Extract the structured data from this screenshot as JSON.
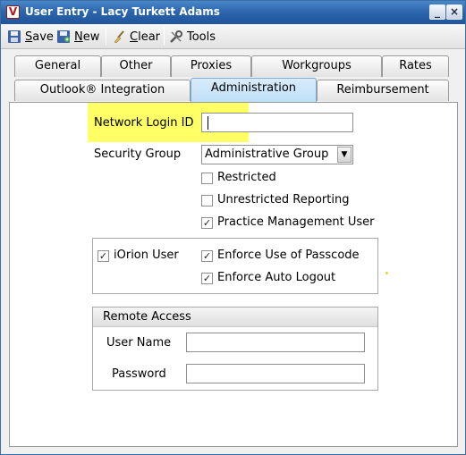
{
  "window": {
    "title": "User Entry - Lacy Turkett Adams",
    "min_glyph": "_",
    "close_glyph": "×"
  },
  "toolbar": {
    "save_label": "Save",
    "new_label": "New",
    "clear_label": "Clear",
    "tools_label": "Tools"
  },
  "tabs_row1": [
    {
      "label": "General"
    },
    {
      "label": "Other"
    },
    {
      "label": "Proxies"
    },
    {
      "label": "Workgroups"
    },
    {
      "label": "Rates"
    }
  ],
  "tabs_row2": [
    {
      "label": "Outlook® Integration"
    },
    {
      "label": "Administration",
      "active": true
    },
    {
      "label": "Reimbursement"
    }
  ],
  "admin": {
    "network_login_label": "Network Login ID",
    "network_login_value": "",
    "security_group_label": "Security Group",
    "security_group_value": "Administrative Group",
    "restricted_label": "Restricted",
    "restricted_checked": false,
    "unrestricted_label": "Unrestricted Reporting",
    "unrestricted_checked": false,
    "practice_label": "Practice Management User",
    "practice_checked": true,
    "iorion_label": "iOrion User",
    "iorion_checked": true,
    "passcode_label": "Enforce Use of Passcode",
    "passcode_checked": true,
    "autologout_label": "Enforce Auto Logout",
    "autologout_checked": true
  },
  "remote_access": {
    "title": "Remote Access",
    "username_label": "User Name",
    "username_value": "",
    "password_label": "Password",
    "password_value": ""
  },
  "colors": {
    "titlebar": "#2d66ad",
    "active_tab": "#bfdff7",
    "highlight": "#ffff66"
  },
  "icons": {
    "app": "app-icon",
    "save": "floppy-disk-icon",
    "new": "new-document-icon",
    "clear": "broom-icon",
    "tools": "wrench-icon"
  }
}
